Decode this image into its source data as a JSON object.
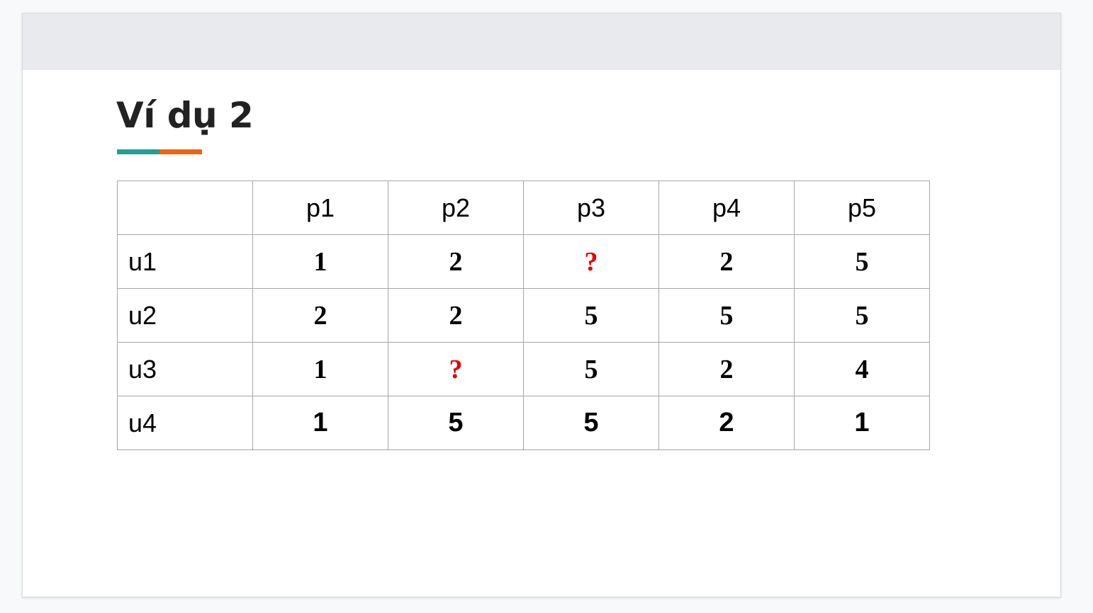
{
  "slide": {
    "title": "Ví dụ 2",
    "underline_colors": [
      "#1fa191",
      "#f26310"
    ]
  },
  "table": {
    "columns": [
      "p1",
      "p2",
      "p3",
      "p4",
      "p5"
    ],
    "rows": [
      {
        "label": "u1",
        "values": [
          "1",
          "2",
          "?",
          "2",
          "5"
        ],
        "font": "serif"
      },
      {
        "label": "u2",
        "values": [
          "2",
          "2",
          "5",
          "5",
          "5"
        ],
        "font": "serif"
      },
      {
        "label": "u3",
        "values": [
          "1",
          "?",
          "5",
          "2",
          "4"
        ],
        "font": "serif"
      },
      {
        "label": "u4",
        "values": [
          "1",
          "5",
          "5",
          "2",
          "1"
        ],
        "font": "sans"
      }
    ],
    "missing_marker": "?",
    "missing_color": "#e60000"
  }
}
